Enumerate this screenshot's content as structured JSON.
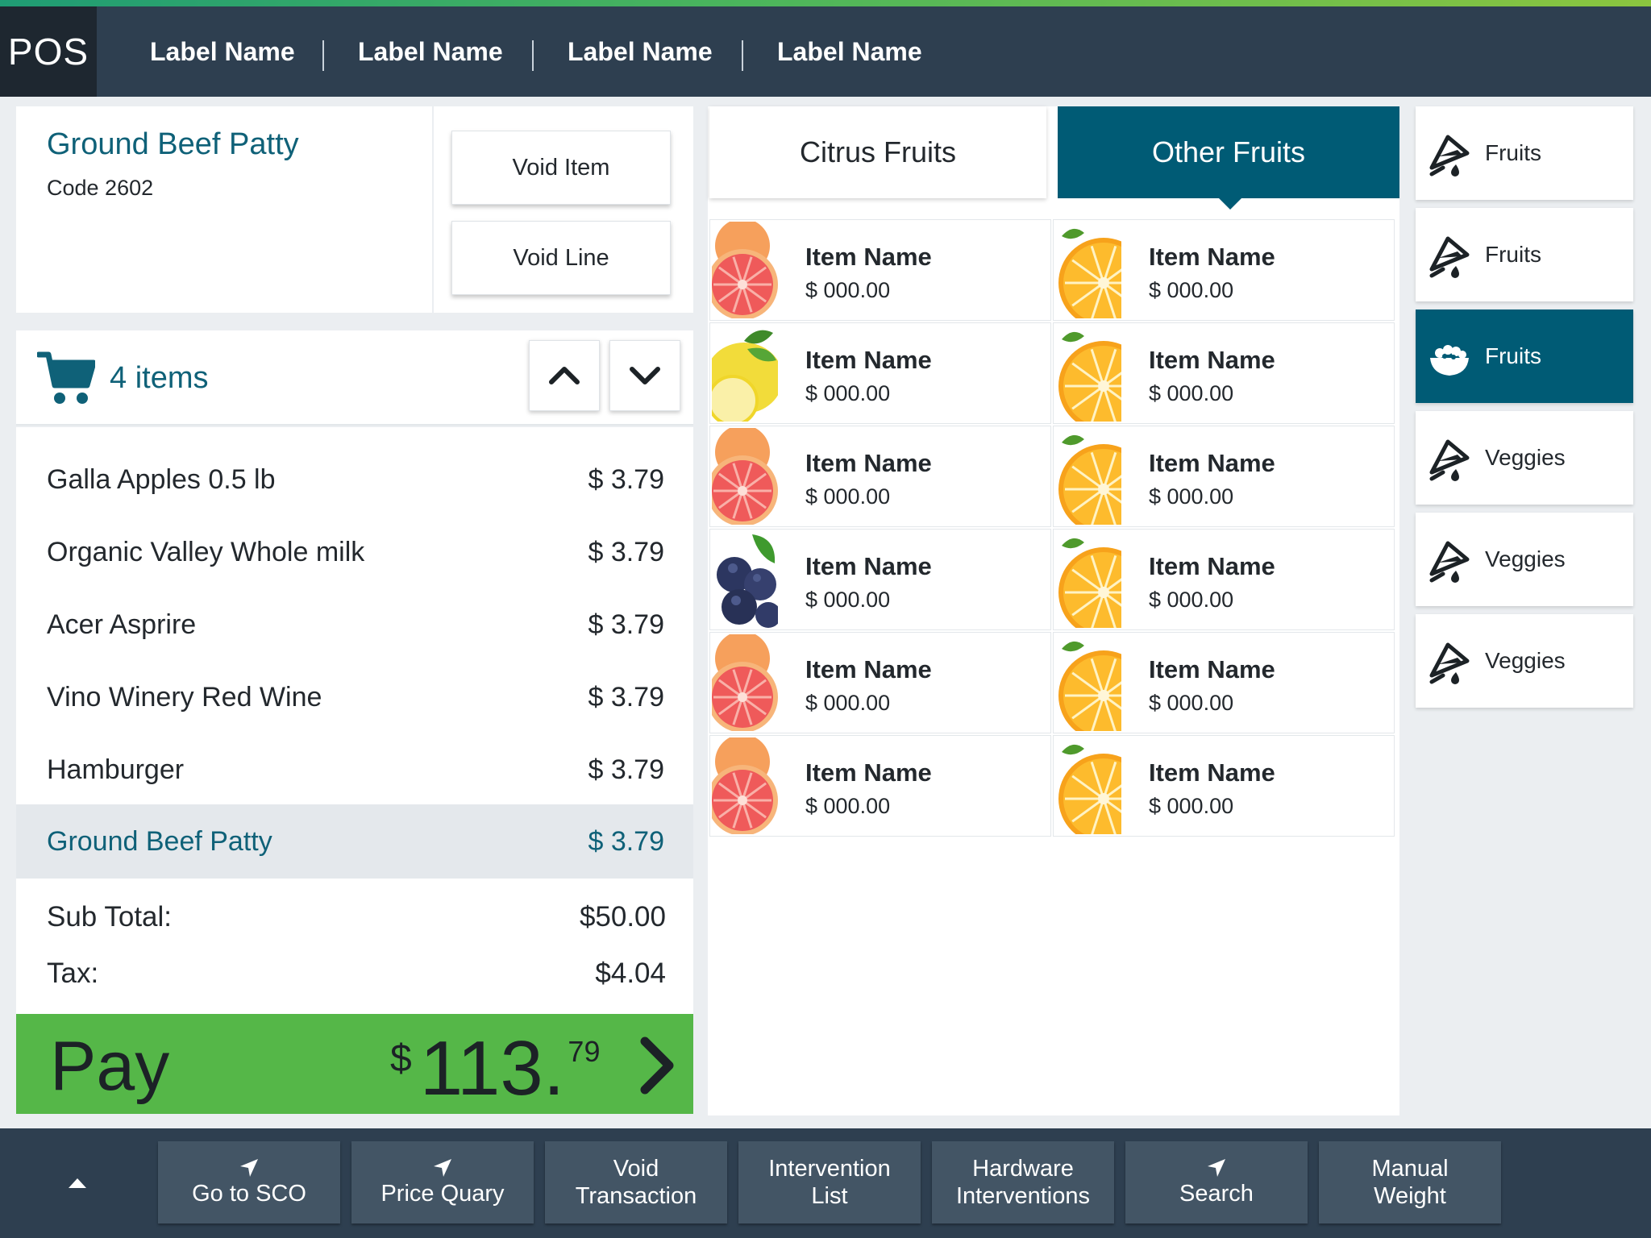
{
  "app": {
    "logo": "POS"
  },
  "nav": {
    "tabs": [
      {
        "label": "Label Name"
      },
      {
        "label": "Label Name"
      },
      {
        "label": "Label Name"
      },
      {
        "label": "Label Name"
      }
    ]
  },
  "selected_item": {
    "name": "Ground Beef Patty",
    "code": "Code 2602",
    "void_item_label": "Void Item",
    "void_line_label": "Void Line"
  },
  "cart": {
    "count_label": "4 items",
    "lines": [
      {
        "name": "Galla Apples 0.5 lb",
        "price": "$ 3.79"
      },
      {
        "name": "Organic Valley Whole milk",
        "price": "$ 3.79"
      },
      {
        "name": "Acer Asprire",
        "price": "$ 3.79"
      },
      {
        "name": "Vino Winery Red Wine",
        "price": "$ 3.79"
      },
      {
        "name": "Hamburger",
        "price": "$ 3.79"
      },
      {
        "name": "Ground Beef Patty",
        "price": "$ 3.79",
        "selected": true
      }
    ]
  },
  "totals": {
    "subtotal_label": "Sub Total:",
    "subtotal_value": "$50.00",
    "tax_label": "Tax:",
    "tax_value": "$4.04"
  },
  "pay": {
    "label": "Pay",
    "currency": "$",
    "amount_whole": "113.",
    "amount_cents": "79",
    "color": "#55b748"
  },
  "category_tabs": [
    {
      "label": "Citrus Fruits",
      "active": false
    },
    {
      "label": "Other Fruits",
      "active": true
    }
  ],
  "products": [
    {
      "name": "Item Name",
      "price": "$ 000.00",
      "image": "grapefruit"
    },
    {
      "name": "Item Name",
      "price": "$ 000.00",
      "image": "orange"
    },
    {
      "name": "Item Name",
      "price": "$ 000.00",
      "image": "lemon"
    },
    {
      "name": "Item Name",
      "price": "$ 000.00",
      "image": "orange"
    },
    {
      "name": "Item Name",
      "price": "$ 000.00",
      "image": "grapefruit"
    },
    {
      "name": "Item Name",
      "price": "$ 000.00",
      "image": "orange"
    },
    {
      "name": "Item Name",
      "price": "$ 000.00",
      "image": "blueberries"
    },
    {
      "name": "Item Name",
      "price": "$ 000.00",
      "image": "orange"
    },
    {
      "name": "Item Name",
      "price": "$ 000.00",
      "image": "grapefruit"
    },
    {
      "name": "Item Name",
      "price": "$ 000.00",
      "image": "orange"
    },
    {
      "name": "Item Name",
      "price": "$ 000.00",
      "image": "grapefruit"
    },
    {
      "name": "Item Name",
      "price": "$ 000.00",
      "image": "orange"
    }
  ],
  "departments": [
    {
      "label": "Fruits",
      "icon": "cocktail-icon",
      "active": false
    },
    {
      "label": "Fruits",
      "icon": "cocktail-icon",
      "active": false
    },
    {
      "label": "Fruits",
      "icon": "fruit-bowl-icon",
      "active": true
    },
    {
      "label": "Veggies",
      "icon": "cocktail-icon",
      "active": false
    },
    {
      "label": "Veggies",
      "icon": "cocktail-icon",
      "active": false
    },
    {
      "label": "Veggies",
      "icon": "cocktail-icon",
      "active": false
    }
  ],
  "bottom_bar": {
    "buttons": [
      {
        "label_top": "",
        "label_bottom": "Go to SCO",
        "icon": "navigation-arrow-icon"
      },
      {
        "label_top": "",
        "label_bottom": "Price Quary",
        "icon": "navigation-arrow-icon"
      },
      {
        "label_top": "Void",
        "label_bottom": "Transaction",
        "icon": ""
      },
      {
        "label_top": "Intervention",
        "label_bottom": "List",
        "icon": ""
      },
      {
        "label_top": "Hardware",
        "label_bottom": "Interventions",
        "icon": ""
      },
      {
        "label_top": "",
        "label_bottom": "Search",
        "icon": "navigation-arrow-icon"
      },
      {
        "label_top": "Manual",
        "label_bottom": "Weight",
        "icon": ""
      }
    ]
  },
  "colors": {
    "header": "#2e3f50",
    "teal": "#005b75",
    "teal_text": "#0f6178",
    "pay_green": "#55b748"
  }
}
